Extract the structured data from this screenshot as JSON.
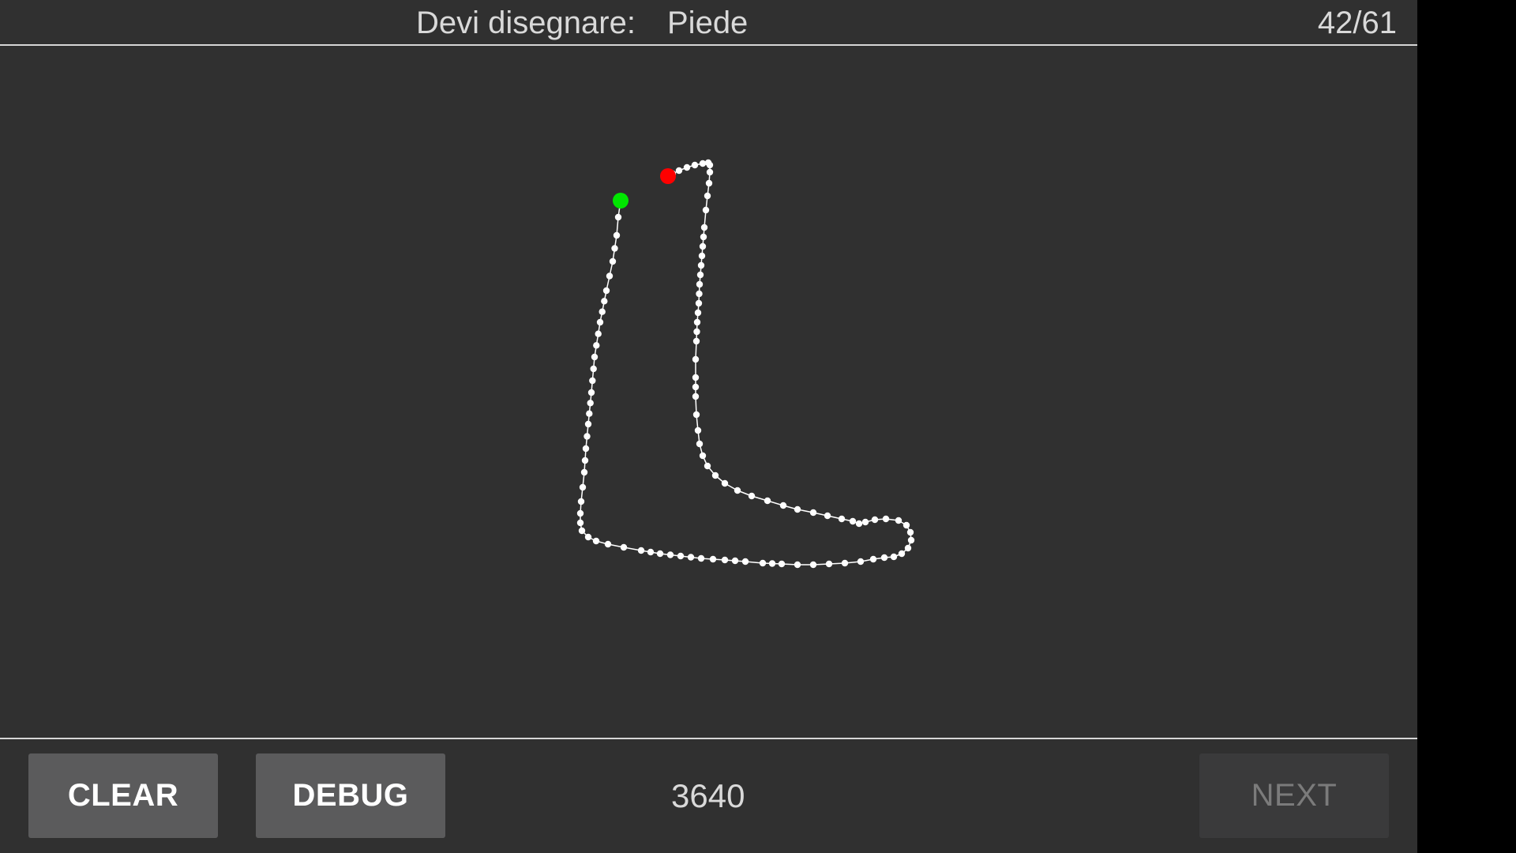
{
  "header": {
    "prompt_label": "Devi disegnare:",
    "prompt_word": "Piede",
    "counter": "42/61"
  },
  "footer": {
    "clear_label": "CLEAR",
    "debug_label": "DEBUG",
    "score": "3640",
    "next_label": "NEXT",
    "next_enabled": false
  },
  "drawing": {
    "stroke_color": "#ffffff",
    "start_marker_color": "#00e600",
    "end_marker_color": "#ff0000"
  },
  "colors": {
    "background": "#303030",
    "divider": "#d6d6d6",
    "button": "#5b5b5c",
    "button_disabled": "#3a3a3b",
    "text": "#d9d9d9"
  }
}
